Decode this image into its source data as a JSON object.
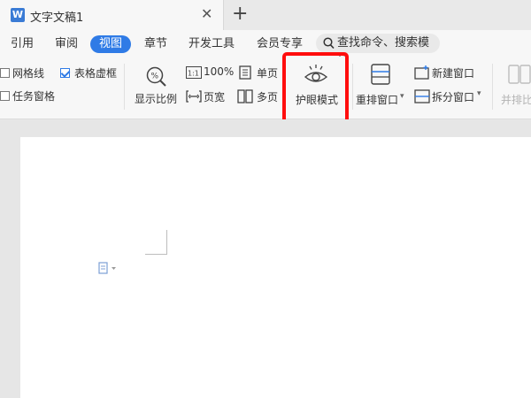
{
  "titlebar": {
    "app_badge": "W",
    "doc_title": "文字文稿1",
    "close_glyph": "✕",
    "new_tab_glyph": "+"
  },
  "menu": {
    "items": [
      "引用",
      "审阅",
      "视图",
      "章节",
      "开发工具",
      "会员专享"
    ],
    "active": "视图",
    "search_text": "查找命令、搜索模板"
  },
  "ribbon": {
    "gridlines_label": "网格线",
    "gridlines_checked": false,
    "table_gridlines_label": "表格虚框",
    "table_gridlines_checked": true,
    "task_pane_label": "任务窗格",
    "task_pane_checked": false,
    "zoom_label": "显示比例",
    "zoom_100_label": "100%",
    "page_width_label": "页宽",
    "single_page_label": "单页",
    "multi_page_label": "多页",
    "eye_care_label": "护眼模式",
    "arrange_label": "重排窗口",
    "new_window_label": "新建窗口",
    "split_window_label": "拆分窗口",
    "side_by_side_label": "并排比",
    "dropdown_glyph": "▾"
  },
  "colors": {
    "accent": "#2f7be6",
    "highlight": "#ff0d0d"
  }
}
